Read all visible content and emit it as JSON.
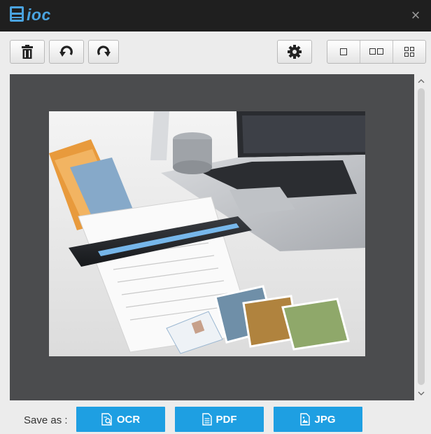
{
  "app": {
    "name": "ioc"
  },
  "window": {
    "close_glyph": "×"
  },
  "toolbar": {
    "buttons": [
      {
        "id": "delete",
        "icon": "trash-icon"
      },
      {
        "id": "rotate-left",
        "icon": "rotate-left-icon"
      },
      {
        "id": "rotate-right",
        "icon": "rotate-right-icon"
      },
      {
        "id": "settings",
        "icon": "gear-icon"
      }
    ],
    "view_modes": [
      {
        "id": "single",
        "icon": "single-page-icon",
        "glyph": "□"
      },
      {
        "id": "double",
        "icon": "two-page-icon",
        "glyph": "□□"
      },
      {
        "id": "grid",
        "icon": "grid-icon",
        "glyph": "⊞"
      }
    ]
  },
  "viewer": {
    "image": "scanner-photo",
    "scroll_position": 0.0
  },
  "bottom": {
    "save_as_label": "Save as :",
    "buttons": [
      {
        "id": "ocr",
        "label": "OCR",
        "icon": "ocr-doc-icon"
      },
      {
        "id": "pdf",
        "label": "PDF",
        "icon": "pdf-doc-icon"
      },
      {
        "id": "jpg",
        "label": "JPG",
        "icon": "image-doc-icon"
      }
    ]
  },
  "colors": {
    "accent": "#1e9fe2",
    "title_bar": "#1f1f1f",
    "viewer_bg": "#4b4c4e",
    "logo": "#4aa3df"
  }
}
